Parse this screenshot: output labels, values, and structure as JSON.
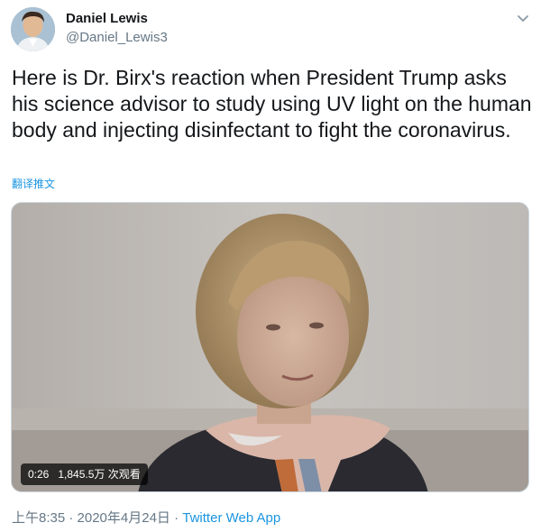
{
  "author": {
    "display_name": "Daniel Lewis",
    "handle": "@Daniel_Lewis3"
  },
  "tweet": {
    "text": "Here is Dr. Birx's reaction when President Trump asks his science advisor to study using UV light on the human body and injecting disinfectant to fight the coronavirus.",
    "translate_label": "翻译推文"
  },
  "video": {
    "duration": "0:26",
    "views": "1,845.5万 次观看"
  },
  "meta": {
    "timestamp": "上午8:35 · 2020年4月24日",
    "separator": "·",
    "source": "Twitter Web App"
  },
  "icons": {
    "caret": "chevron-down-icon"
  },
  "colors": {
    "link": "#1b95e0",
    "secondary_text": "#657786",
    "primary_text": "#14171a"
  }
}
